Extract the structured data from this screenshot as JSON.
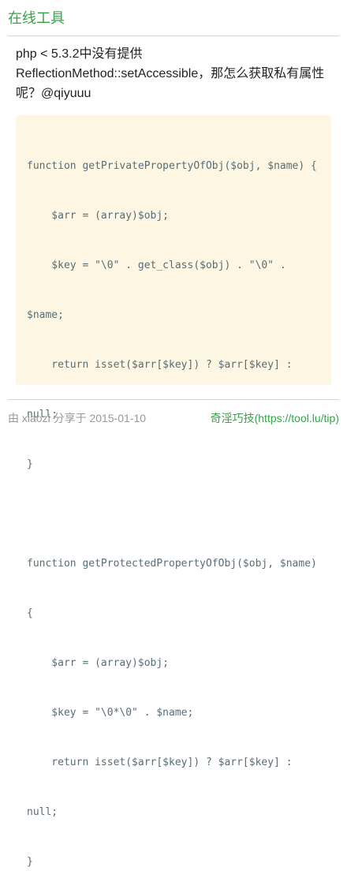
{
  "header": {
    "site_title": "在线工具"
  },
  "question": {
    "line1": "php < 5.3.2中没有提供",
    "line2": "ReflectionMethod::setAccessible，那怎么获取私有属性",
    "line3": "呢？@qiyuuu"
  },
  "code_lines": [
    "function getPrivatePropertyOfObj($obj, $name) {",
    "    $arr = (array)$obj;",
    "    $key = \"\\0\" . get_class($obj) . \"\\0\" .",
    "$name;",
    "    return isset($arr[$key]) ? $arr[$key] :",
    "null;",
    "}",
    "",
    "function getProtectedPropertyOfObj($obj, $name)",
    "{",
    "    $arr = (array)$obj;",
    "    $key = \"\\0*\\0\" . $name;",
    "    return isset($arr[$key]) ? $arr[$key] :",
    "null;",
    "}"
  ],
  "footer": {
    "meta": "由 xiaozi 分享于 2015-01-10",
    "brand": "奇淫巧技(https://tool.lu/tip)"
  },
  "colors": {
    "brand_green": "#3aa24a",
    "code_bg": "#fdf6e3"
  }
}
